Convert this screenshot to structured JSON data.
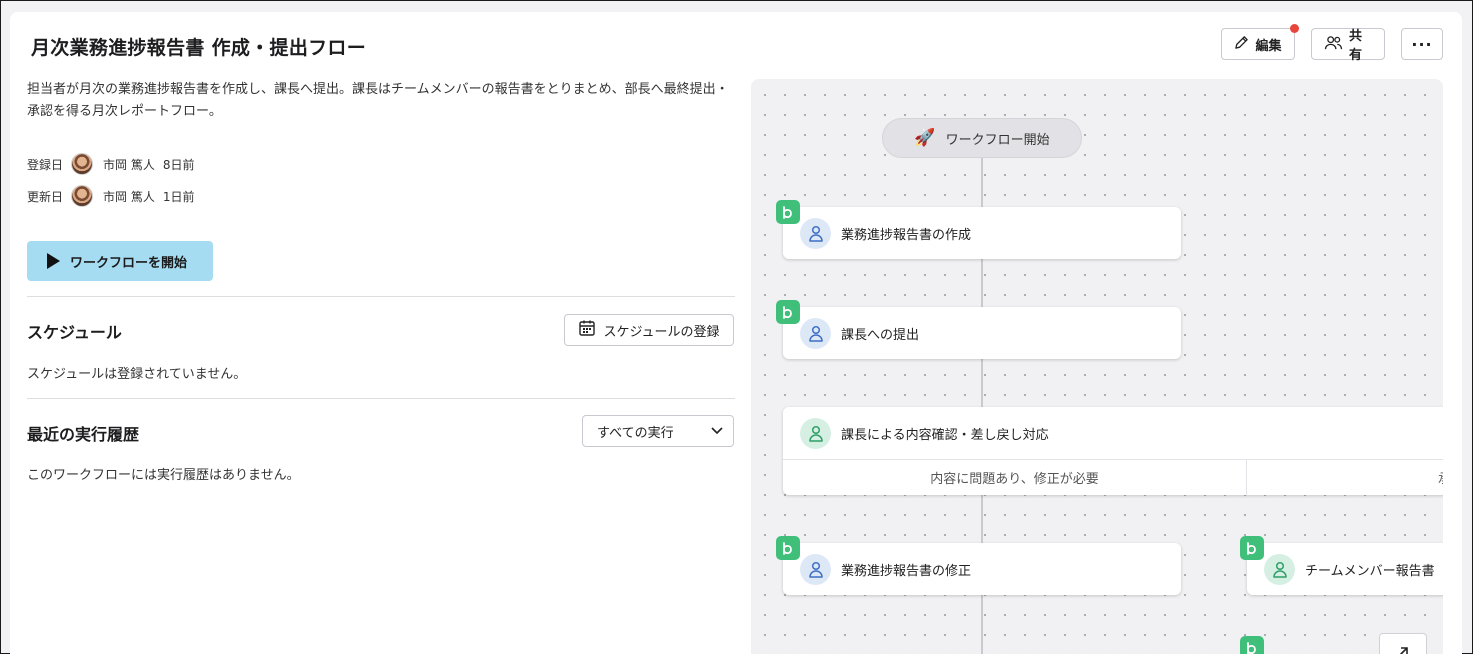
{
  "header": {
    "title": "月次業務進捗報告書 作成・提出フロー",
    "edit_label": "編集",
    "share_label": "共有",
    "more_label": "···"
  },
  "description": "担当者が月次の業務進捗報告書を作成し、課長へ提出。課長はチームメンバーの報告書をとりまとめ、部長へ最終提出・承認を得る月次レポートフロー。",
  "meta": {
    "created": {
      "label": "登録日",
      "user": "市岡 篤人",
      "time": "8日前"
    },
    "updated": {
      "label": "更新日",
      "user": "市岡 篤人",
      "time": "1日前"
    }
  },
  "start_button_label": "ワークフローを開始",
  "schedule": {
    "title": "スケジュール",
    "button_label": "スケジュールの登録",
    "empty_text": "スケジュールは登録されていません。"
  },
  "history": {
    "title": "最近の実行履歴",
    "filter_selected": "すべての実行",
    "empty_text": "このワークフローには実行履歴はありません。"
  },
  "flow": {
    "start_label": "ワークフロー開始",
    "nodes": [
      {
        "label": "業務進捗報告書の作成"
      },
      {
        "label": "課長への提出"
      },
      {
        "label": "課長による内容確認・差し戻し対応"
      },
      {
        "label": "業務進捗報告書の修正"
      },
      {
        "label": "チームメンバー報告書"
      }
    ],
    "branches": [
      "内容に問題あり、修正が必要",
      "承"
    ]
  },
  "colors": {
    "accent": "#a5dcf2",
    "badge_green": "#3fbf7a",
    "notification": "#e8453c"
  }
}
